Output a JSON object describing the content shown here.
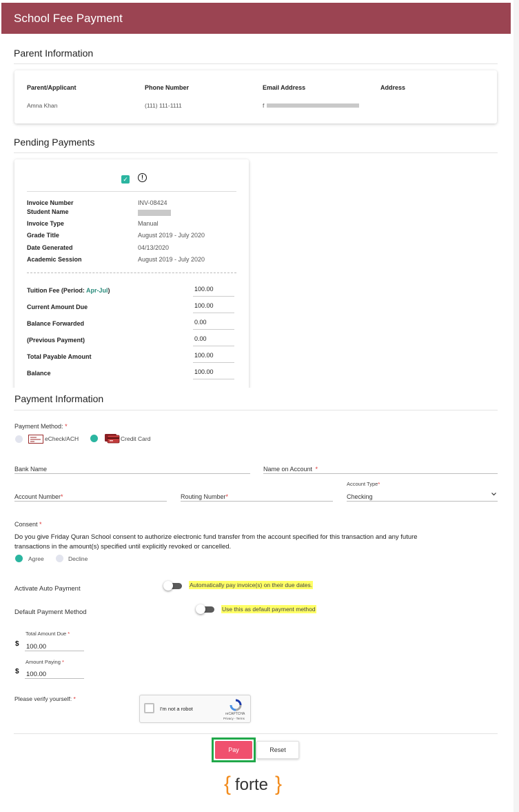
{
  "header": {
    "title": "School Fee Payment"
  },
  "parent_info": {
    "title": "Parent Information",
    "columns": [
      "Parent/Applicant",
      "Phone Number",
      "Email Address",
      "Address"
    ],
    "values": {
      "name": "Amna Khan",
      "phone": "(111) 111-1111",
      "email": "f",
      "address": ""
    }
  },
  "pending": {
    "title": "Pending Payments",
    "details": [
      {
        "label": "Invoice Number",
        "value": "INV-08424"
      },
      {
        "label": "Student Name",
        "value": ""
      },
      {
        "label": "Invoice Type",
        "value": "Manual"
      },
      {
        "label": "Grade Title",
        "value": "August 2019 - July 2020"
      },
      {
        "label": "Date Generated",
        "value": "04/13/2020"
      },
      {
        "label": "Academic Session",
        "value": "August 2019 - July 2020"
      }
    ],
    "tuition_label": "Tuition Fee (Period: ",
    "tuition_period": "Apr-Jul",
    "tuition_close": ")",
    "amounts": [
      {
        "label": "Tuition Fee (Period: Apr-Jul)",
        "value": "100.00"
      },
      {
        "label": "Current Amount Due",
        "value": "100.00"
      },
      {
        "label": "Balance Forwarded",
        "value": "0.00"
      },
      {
        "label": "(Previous Payment)",
        "value": "0.00"
      },
      {
        "label": "Total Payable Amount",
        "value": "100.00"
      },
      {
        "label": "Balance",
        "value": "100.00"
      }
    ]
  },
  "payment": {
    "title": "Payment Information",
    "method_label": "Payment Method:",
    "req": "*",
    "methods": [
      {
        "label": "eCheck/ACH",
        "selected": false
      },
      {
        "label": "Credit Card",
        "selected": true
      }
    ],
    "bank_name": "Bank Name",
    "name_on_account": "Name on Account",
    "account_number": "Account Number",
    "routing_number": "Routing Number",
    "account_type_label": "Account Type",
    "account_type_value": "Checking",
    "consent_label": "Consent",
    "consent_text_1": "Do you give Friday Quran School consent to authorize electronic fund transfer from the account specified for this transaction and any future",
    "consent_text_2": "transactions in the amount(s) specified until explicitly revoked or cancelled.",
    "agree": "Agree",
    "decline": "Decline",
    "auto_payment_label": "Activate Auto Payment",
    "auto_payment_hint": "Automatically pay invoice(s) on their due dates.",
    "default_method_label": "Default Payment Method",
    "default_method_hint": "Use this as default payment method",
    "total_due_label": "Total Amount Due",
    "total_due_value": "100.00",
    "amount_paying_label": "Amount Paying",
    "amount_paying_value": "100.00",
    "currency": "$",
    "verify_label": "Please verify yourself:",
    "recaptcha_text": "I'm not a robot",
    "recaptcha_brand": "reCAPTCHA",
    "recaptcha_links": "Privacy - Terms",
    "pay_button": "Pay",
    "reset_button": "Reset",
    "brand_logo": "forte"
  },
  "colors": {
    "header": "#9b4452",
    "accent": "#2bb5a0",
    "pay": "#f0506e",
    "highlight": "#ffff66",
    "brand": "#f28c1e"
  }
}
